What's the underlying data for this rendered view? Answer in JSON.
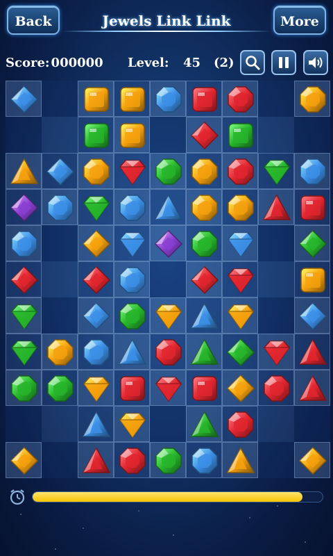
{
  "header": {
    "back_label": "Back",
    "title": "Jewels Link Link",
    "more_label": "More"
  },
  "status": {
    "score_label": "Score:",
    "score_value": "000000",
    "level_label": "Level:",
    "level_value": "45",
    "hints_remaining": "(2)"
  },
  "toolbar": {
    "search_icon": "search-icon",
    "pause_icon": "pause-icon",
    "sound_icon": "sound-icon"
  },
  "timer": {
    "icon": "alarm-clock-icon",
    "fill_fraction": 0.93,
    "color": "#f5c400"
  },
  "colors": {
    "blue": "#3c8fe6",
    "orange": "#f5a10e",
    "red": "#e0262f",
    "green": "#27b52c",
    "purple": "#8a3fd1"
  },
  "board": {
    "rows": 11,
    "cols": 9,
    "grid": [
      [
        "blue-diamond",
        "",
        "orange-square",
        "orange-square",
        "blue-octagon",
        "red-square",
        "red-octagon",
        "",
        "orange-octagon"
      ],
      [
        "",
        "",
        "green-square",
        "orange-square",
        "",
        "red-diamond",
        "green-square",
        "",
        ""
      ],
      [
        "orange-triangle",
        "blue-diamond",
        "orange-octagon",
        "red-gem",
        "green-octagon",
        "orange-octagon",
        "red-octagon",
        "green-gem",
        "blue-octagon"
      ],
      [
        "purple-diamond",
        "blue-octagon",
        "green-gem",
        "blue-octagon",
        "blue-triangle",
        "orange-octagon",
        "orange-octagon",
        "red-triangle",
        "red-square"
      ],
      [
        "blue-octagon",
        "",
        "orange-diamond",
        "blue-gem",
        "purple-diamond",
        "green-octagon",
        "blue-gem",
        "",
        "green-diamond"
      ],
      [
        "red-diamond",
        "",
        "red-diamond",
        "blue-octagon",
        "",
        "red-diamond",
        "red-gem",
        "",
        "orange-square"
      ],
      [
        "green-gem",
        "",
        "blue-diamond",
        "green-octagon",
        "orange-gem",
        "blue-triangle",
        "orange-gem",
        "",
        "blue-diamond"
      ],
      [
        "green-gem",
        "orange-octagon",
        "blue-octagon",
        "blue-triangle",
        "red-octagon",
        "green-triangle",
        "green-diamond",
        "red-gem",
        "red-triangle"
      ],
      [
        "green-octagon",
        "green-octagon",
        "orange-gem",
        "red-square",
        "red-gem",
        "red-square",
        "orange-diamond",
        "red-octagon",
        "red-triangle"
      ],
      [
        "",
        "",
        "blue-triangle",
        "orange-gem",
        "",
        "green-triangle",
        "red-octagon",
        "",
        ""
      ],
      [
        "orange-diamond",
        "",
        "red-triangle",
        "red-octagon",
        "green-octagon",
        "blue-octagon",
        "orange-triangle",
        "",
        "orange-diamond"
      ]
    ]
  }
}
